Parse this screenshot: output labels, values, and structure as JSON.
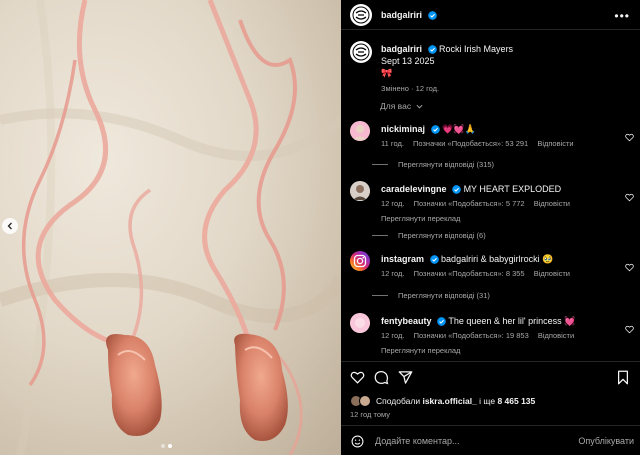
{
  "post": {
    "username": "badgalriri",
    "caption_text": "Rocki Irish Mayers",
    "caption_date": "Sept 13 2025",
    "caption_emoji": "🎀",
    "caption_meta": "Змінено · 12 год.",
    "sort_label": "Для вас"
  },
  "comments": [
    {
      "username": "nickiminaj",
      "text": "💗💓🙏",
      "time": "11 год.",
      "tags": "Позначки «Подобається»: 53 291",
      "reply": "Відповісти",
      "view_replies": "Переглянути відповіді (315)"
    },
    {
      "username": "caradelevingne",
      "text": "MY HEART EXPLODED",
      "time": "12 год.",
      "tags": "Позначки «Подобається»: 5 772",
      "reply": "Відповісти",
      "translate": "Переглянути переклад",
      "view_replies": "Переглянути відповіді (6)"
    },
    {
      "username": "instagram",
      "text": "badgalriri & babygirlrocki 🥹",
      "time": "12 год.",
      "tags": "Позначки «Подобається»: 8 355",
      "reply": "Відповісти",
      "view_replies": "Переглянути відповіді (31)"
    },
    {
      "username": "fentybeauty",
      "text": "The queen & her lil' princess 💓",
      "time": "12 год.",
      "tags": "Позначки «Подобається»: 19 853",
      "reply": "Відповісти",
      "translate": "Переглянути переклад"
    }
  ],
  "likes": {
    "prefix": "Сподобали",
    "user": "iskra.official_",
    "middle": "і ще",
    "count": "8 465 135"
  },
  "time_ago": "12 год тому",
  "composer": {
    "placeholder": "Додайте коментар...",
    "post_label": "Опублікувати"
  },
  "icons": {
    "verified": "verified-badge-icon",
    "like": "heart-icon",
    "comment": "comment-icon",
    "share": "share-icon",
    "save": "bookmark-icon",
    "emoji": "emoji-icon",
    "more": "more-icon"
  },
  "colors": {
    "verified": "#0095f6",
    "background": "#000000",
    "muted": "#a8a8a8"
  }
}
